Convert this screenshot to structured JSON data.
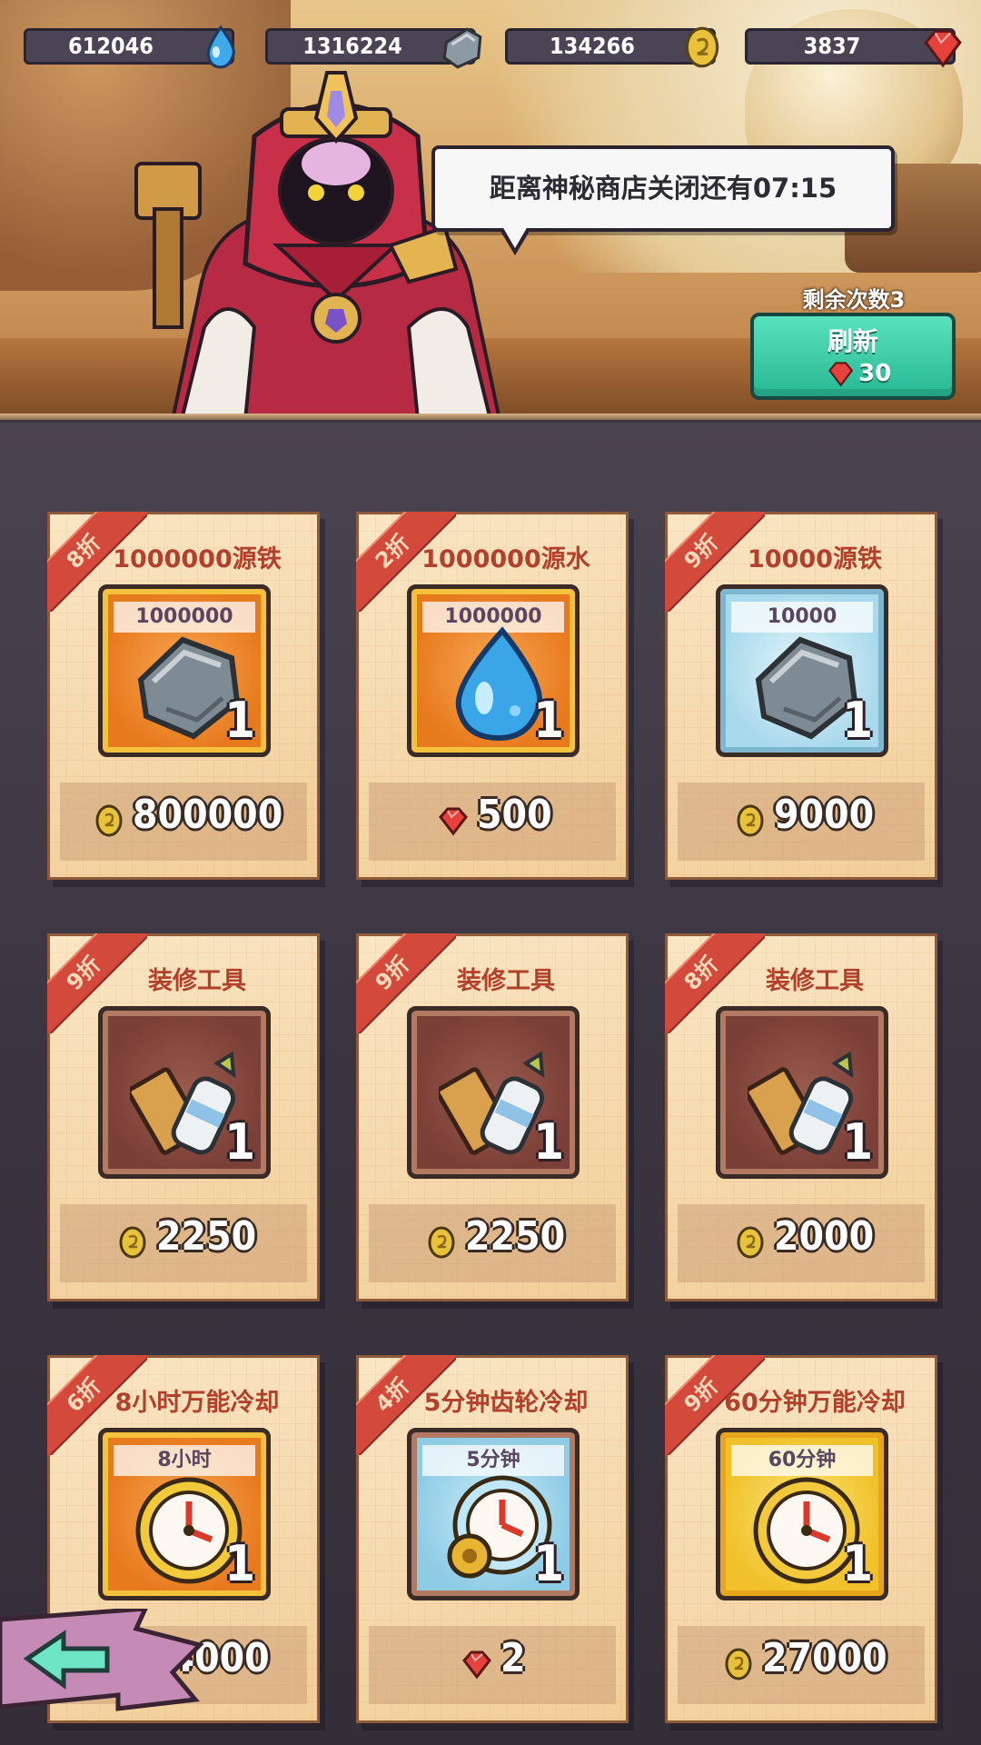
{
  "currencies": [
    {
      "value": "612046",
      "icon": "water-drop-icon"
    },
    {
      "value": "1316224",
      "icon": "iron-ore-icon"
    },
    {
      "value": "134266",
      "icon": "gold-coin-icon"
    },
    {
      "value": "3837",
      "icon": "red-gem-icon"
    }
  ],
  "speech": {
    "text": "距离神秘商店关闭还有07:15"
  },
  "refresh": {
    "remaining_label": "剩余次数3",
    "button_label": "刷新",
    "cost": "30",
    "cost_icon": "red-gem-icon"
  },
  "items": [
    {
      "discount": "8折",
      "name": "1000000源铁",
      "qty_tag": "1000000",
      "count": "1",
      "frame": "gold",
      "icon": "iron-ore-icon",
      "price_icon": "gold-coin-icon",
      "price": "800000"
    },
    {
      "discount": "2折",
      "name": "1000000源水",
      "qty_tag": "1000000",
      "count": "1",
      "frame": "gold",
      "icon": "water-drop-icon",
      "price_icon": "red-gem-icon",
      "price": "500"
    },
    {
      "discount": "9折",
      "name": "10000源铁",
      "qty_tag": "10000",
      "count": "1",
      "frame": "blue",
      "icon": "iron-ore-icon",
      "price_icon": "gold-coin-icon",
      "price": "9000"
    },
    {
      "discount": "9折",
      "name": "装修工具",
      "qty_tag": "",
      "count": "1",
      "frame": "brown",
      "icon": "renovation-tools-icon",
      "price_icon": "gold-coin-icon",
      "price": "2250"
    },
    {
      "discount": "9折",
      "name": "装修工具",
      "qty_tag": "",
      "count": "1",
      "frame": "brown",
      "icon": "renovation-tools-icon",
      "price_icon": "gold-coin-icon",
      "price": "2250"
    },
    {
      "discount": "8折",
      "name": "装修工具",
      "qty_tag": "",
      "count": "1",
      "frame": "brown",
      "icon": "renovation-tools-icon",
      "price_icon": "gold-coin-icon",
      "price": "2000"
    },
    {
      "discount": "6折",
      "name": "8小时万能冷却",
      "qty_tag": "8小时",
      "count": "1",
      "frame": "gold",
      "icon": "clock-icon",
      "price_icon": "gold-coin-icon",
      "price": "14000"
    },
    {
      "discount": "4折",
      "name": "5分钟齿轮冷却",
      "qty_tag": "5分钟",
      "count": "1",
      "frame": "sky",
      "icon": "gear-clock-icon",
      "price_icon": "red-gem-icon",
      "price": "2"
    },
    {
      "discount": "9折",
      "name": "60分钟万能冷却",
      "qty_tag": "60分钟",
      "count": "1",
      "frame": "yellow",
      "icon": "clock-icon",
      "price_icon": "gold-coin-icon",
      "price": "27000"
    }
  ],
  "nav": {
    "back_icon": "back-arrow-icon"
  },
  "colors": {
    "ribbon": "#d3493c",
    "refresh_button": "#3fd0aa",
    "item_name": "#b1402d"
  }
}
